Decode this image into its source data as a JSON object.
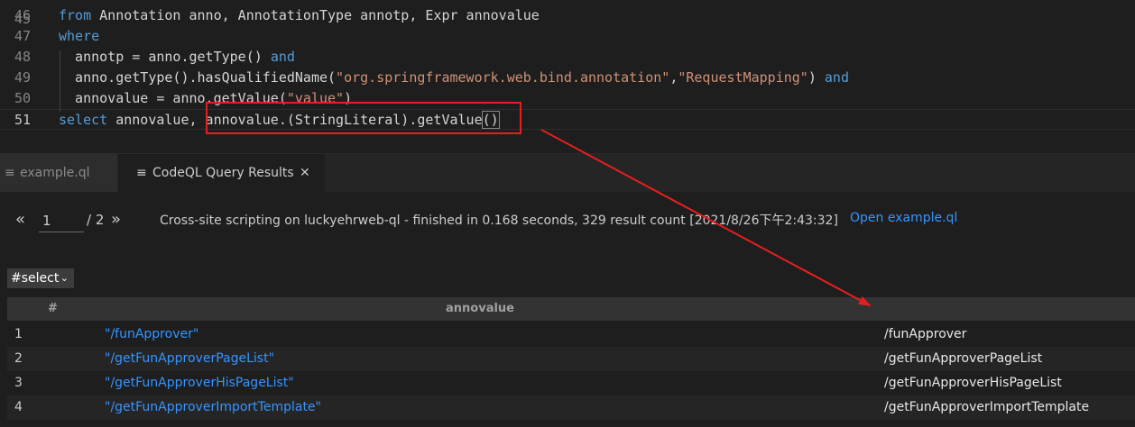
{
  "editor": {
    "partial_line_number": "45",
    "lines": [
      {
        "number": "46",
        "tokens": [
          {
            "t": "kw",
            "v": "from"
          },
          {
            "t": "tx",
            "v": " Annotation anno, AnnotationType annotp, Expr annovalue"
          }
        ]
      },
      {
        "number": "47",
        "tokens": [
          {
            "t": "kw",
            "v": "where"
          }
        ]
      },
      {
        "number": "48",
        "tokens": [
          {
            "t": "tx",
            "v": "  annotp = anno.getType() "
          },
          {
            "t": "kw",
            "v": "and"
          }
        ]
      },
      {
        "number": "49",
        "tokens": [
          {
            "t": "tx",
            "v": "  anno.getType().hasQualifiedName("
          },
          {
            "t": "st",
            "v": "\"org.springframework.web.bind.annotation\""
          },
          {
            "t": "tx",
            "v": ","
          },
          {
            "t": "st",
            "v": "\"RequestMapping\""
          },
          {
            "t": "tx",
            "v": ") "
          },
          {
            "t": "kw",
            "v": "and"
          }
        ]
      },
      {
        "number": "50",
        "tokens": [
          {
            "t": "tx",
            "v": "  annovalue = anno.getValue("
          },
          {
            "t": "st",
            "v": "\"value\""
          },
          {
            "t": "tx",
            "v": ")"
          }
        ]
      },
      {
        "number": "51",
        "tokens": [
          {
            "t": "kw",
            "v": "select"
          },
          {
            "t": "tx",
            "v": " annovalue, annovalue.(StringLiteral).getValue"
          },
          {
            "t": "br",
            "v": "()"
          }
        ]
      }
    ]
  },
  "tabs": [
    {
      "label": "example.ql",
      "icon": "file-lines-icon"
    },
    {
      "label": "CodeQL Query Results",
      "icon": "file-lines-icon",
      "close": "✕"
    }
  ],
  "pager": {
    "prev": "«",
    "current_page": "1",
    "total": "/ 2",
    "next": "»"
  },
  "status": "Cross-site scripting on luckyehrweb-ql - finished in 0.168 seconds, 329 result count [2021/8/26下午2:43:32]",
  "open_link": "Open example.ql",
  "result_set_select": "#select",
  "table": {
    "headers": [
      "#",
      "annovalue"
    ],
    "rows": [
      {
        "num": "1",
        "literal": "\"/funApprover\"",
        "value": "/funApprover"
      },
      {
        "num": "2",
        "literal": "\"/getFunApproverPageList\"",
        "value": "/getFunApproverPageList"
      },
      {
        "num": "3",
        "literal": "\"/getFunApproverHisPageList\"",
        "value": "/getFunApproverHisPageList"
      },
      {
        "num": "4",
        "literal": "\"/getFunApproverImportTemplate\"",
        "value": "/getFunApproverImportTemplate"
      }
    ]
  },
  "colors": {
    "keyword": "#569cd6",
    "string": "#ce9178",
    "link": "#3794ff",
    "annotation": "#e51f1f"
  }
}
